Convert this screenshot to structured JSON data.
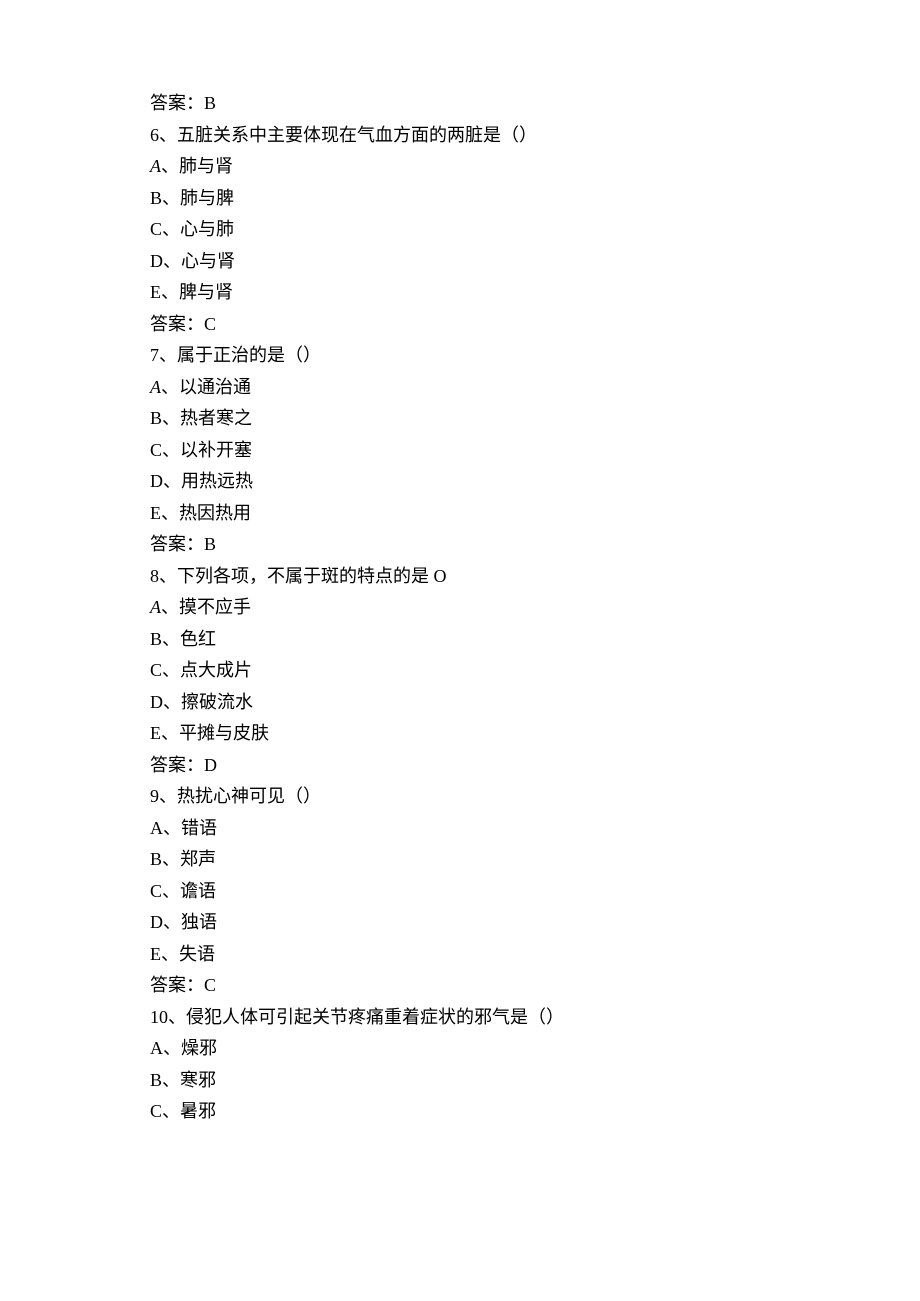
{
  "lines": [
    {
      "key": "ans5",
      "text": "答案：B"
    },
    {
      "key": "q6_stem",
      "text": "6、五脏关系中主要体现在气血方面的两脏是（）"
    },
    {
      "key": "q6_a",
      "text": "A、肺与肾",
      "italicA": true
    },
    {
      "key": "q6_b",
      "text": "B、肺与脾"
    },
    {
      "key": "q6_c",
      "text": "C、心与肺"
    },
    {
      "key": "q6_d",
      "text": "D、心与肾"
    },
    {
      "key": "q6_e",
      "text": "E、脾与肾"
    },
    {
      "key": "ans6",
      "text": "答案：C"
    },
    {
      "key": "q7_stem",
      "text": "7、属于正治的是（）"
    },
    {
      "key": "q7_a",
      "text": "A、以通治通",
      "italicA": true
    },
    {
      "key": "q7_b",
      "text": "B、热者寒之"
    },
    {
      "key": "q7_c",
      "text": "C、以补开塞"
    },
    {
      "key": "q7_d",
      "text": "D、用热远热"
    },
    {
      "key": "q7_e",
      "text": "E、热因热用"
    },
    {
      "key": "ans7",
      "text": "答案：B"
    },
    {
      "key": "q8_stem",
      "text": "8、下列各项，不属于斑的特点的是 O"
    },
    {
      "key": "q8_a",
      "text": "A、摸不应手",
      "italicA": true
    },
    {
      "key": "q8_b",
      "text": "B、色红"
    },
    {
      "key": "q8_c",
      "text": "C、点大成片"
    },
    {
      "key": "q8_d",
      "text": "D、擦破流水"
    },
    {
      "key": "q8_e",
      "text": "E、平摊与皮肤"
    },
    {
      "key": "ans8",
      "text": "答案：D"
    },
    {
      "key": "q9_stem",
      "text": "9、热扰心神可见（）"
    },
    {
      "key": "q9_a",
      "text": "A、错语"
    },
    {
      "key": "q9_b",
      "text": "B、郑声"
    },
    {
      "key": "q9_c",
      "text": "C、谵语"
    },
    {
      "key": "q9_d",
      "text": "D、独语"
    },
    {
      "key": "q9_e",
      "text": "E、失语"
    },
    {
      "key": "ans9",
      "text": "答案：C"
    },
    {
      "key": "q10_stem",
      "text": "10、侵犯人体可引起关节疼痛重着症状的邪气是（）"
    },
    {
      "key": "q10_a",
      "text": "A、燥邪"
    },
    {
      "key": "q10_b",
      "text": "B、寒邪"
    },
    {
      "key": "q10_c",
      "text": "C、暑邪"
    }
  ]
}
